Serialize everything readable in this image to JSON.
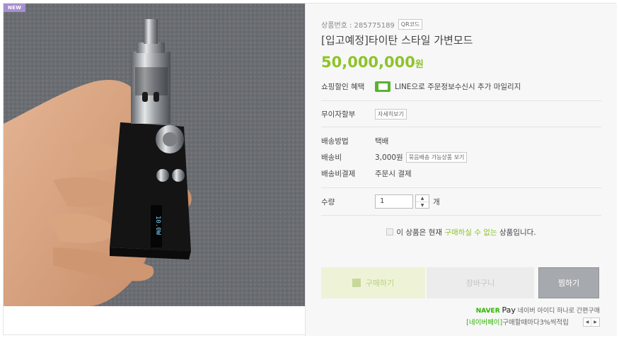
{
  "image": {
    "badge": "NEW"
  },
  "product": {
    "code_label": "상품번호 : 285775189",
    "qr_label": "QR코드",
    "title": "[입고예정]타이탄 스타일 가변모드",
    "price": "50,000,000",
    "currency": "원"
  },
  "benefit": {
    "label": "쇼핑할인 혜택",
    "text": "LINE으로 주문정보수신시 추가 마일리지"
  },
  "installment": {
    "label": "무이자할부",
    "button": "자세히보기"
  },
  "shipping": {
    "method_label": "배송방법",
    "method_value": "택배",
    "fee_label": "배송비",
    "fee_value": "3,000원",
    "fee_button": "묶음배송 가능상품 보기",
    "pay_label": "배송비결제",
    "pay_value": "주문시 결제"
  },
  "quantity": {
    "label": "수량",
    "value": "1",
    "unit": "개"
  },
  "notice": {
    "prefix": "이 상품은 현재",
    "highlight": "구매하실 수 없는",
    "suffix": "상품입니다."
  },
  "actions": {
    "buy": "구매하기",
    "cart": "장바구니",
    "wish": "찜하기"
  },
  "naverpay": {
    "brand": "NAVER",
    "pay": "Pay",
    "tagline": "네이버 아이디 하나로 간편구매",
    "point_highlight": "[네이버페이]",
    "point_text": "구매할때마다3%씩적립"
  },
  "colors": {
    "accent": "#8ec32a",
    "naver_green": "#2db400"
  }
}
